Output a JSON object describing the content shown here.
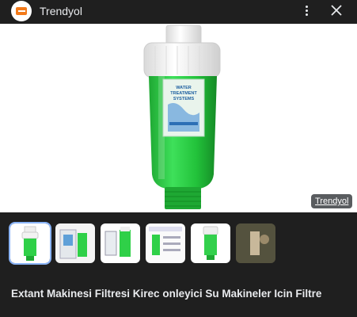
{
  "header": {
    "site_name": "Trendyol",
    "logo_icon": "trendyol-logo-icon",
    "menu_icon": "more-vert-icon",
    "close_icon": "close-icon"
  },
  "image": {
    "source_badge": "Trendyol",
    "label_lines": [
      "WATER",
      "TREATMENT",
      "SYSTEMS"
    ],
    "brand_color": "#f27a1a"
  },
  "thumbnails": [
    {
      "name": "thumb-1",
      "selected": true
    },
    {
      "name": "thumb-2",
      "selected": false
    },
    {
      "name": "thumb-3",
      "selected": false
    },
    {
      "name": "thumb-4",
      "selected": false
    },
    {
      "name": "thumb-5",
      "selected": false
    },
    {
      "name": "thumb-6",
      "selected": false
    }
  ],
  "product": {
    "title": "Extant Makinesi Filtresi Kirec onleyici Su Makineler Icin Filtre"
  },
  "colors": {
    "background": "#1f1f1f",
    "accent": "#8ab4f8",
    "filter_green": "#22c23a"
  }
}
